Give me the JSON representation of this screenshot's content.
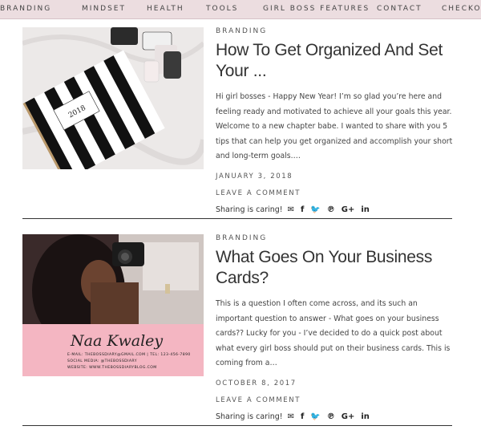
{
  "nav": {
    "items": [
      "Branding",
      "Mindset",
      "Health",
      "Tools",
      "Girl Boss Features",
      "Contact",
      "Checkout"
    ]
  },
  "posts": [
    {
      "category": "Branding",
      "title": "How To Get Organized And Set Your ...",
      "excerpt": "Hi girl bosses - Happy New Year! I’m so glad you’re here and feeling ready and motivated to achieve all your goals this year. Welcome to a new chapter babe. I wanted to share with you 5 tips that can help you get organized and accomplish your short and long-term goals.…",
      "date": "January 3, 2018",
      "comment": "Leave a Comment",
      "share_label": "Sharing is caring!",
      "planner_year": "2018"
    },
    {
      "category": "Branding",
      "title": "What Goes On Your Business Cards?",
      "excerpt": "This is a question I often come across, and its such an important question to answer - What goes on your business cards?? Lucky for you - I’ve decided to do a quick post about what every girl boss should put on their business cards. This is coming from a…",
      "date": "October 8, 2017",
      "comment": "Leave a Comment",
      "share_label": "Sharing is caring!",
      "card": {
        "name": "Naa Kwaley",
        "line1": "E-mail: thebossdiary@gmail.com | Tel: 123-456-7890",
        "line2": "Social Media: @thebossdiary",
        "line3": "Website: www.thebossdiaryblog.com"
      }
    }
  ],
  "share_icons": [
    "envelope-icon",
    "facebook-icon",
    "twitter-icon",
    "pinterest-icon",
    "google-plus-icon",
    "linkedin-icon"
  ],
  "colors": {
    "nav_bg": "#ecdde0",
    "card_pink": "#f4b6c2"
  }
}
